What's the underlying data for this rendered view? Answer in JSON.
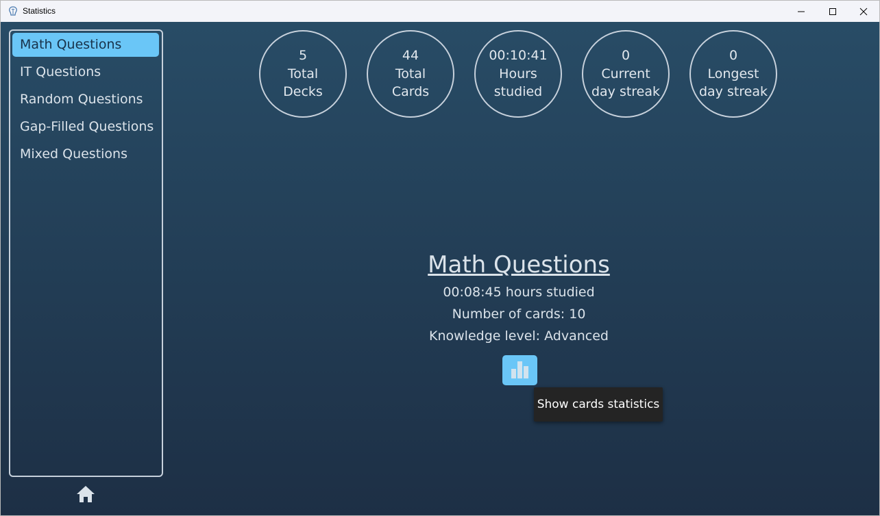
{
  "window": {
    "title": "Statistics",
    "minimize_icon": "minimize-icon",
    "maximize_icon": "maximize-icon",
    "close_icon": "close-icon"
  },
  "sidebar": {
    "items": [
      {
        "label": "Math Questions",
        "selected": true
      },
      {
        "label": "IT Questions",
        "selected": false
      },
      {
        "label": "Random Questions",
        "selected": false
      },
      {
        "label": "Gap-Filled Questions",
        "selected": false
      },
      {
        "label": "Mixed Questions",
        "selected": false
      }
    ],
    "home_icon": "home-icon"
  },
  "summary": [
    {
      "value": "5",
      "line1": "Total",
      "line2": "Decks"
    },
    {
      "value": "44",
      "line1": "Total",
      "line2": "Cards"
    },
    {
      "value": "00:10:41",
      "line1": "Hours",
      "line2": "studied"
    },
    {
      "value": "0",
      "line1": "Current",
      "line2": "day streak"
    },
    {
      "value": "0",
      "line1": "Longest",
      "line2": "day streak"
    }
  ],
  "deck": {
    "title": "Math Questions",
    "hours": "00:08:45 hours studied",
    "cards": "Number of cards: 10",
    "knowledge": "Knowledge level: Advanced",
    "stats_button_icon": "bar-chart-icon",
    "tooltip": "Show cards statistics"
  },
  "colors": {
    "accent": "#6ac6f7",
    "background_top": "#284c66",
    "background_bottom": "#1d2f45",
    "text": "#dbe3ea"
  }
}
